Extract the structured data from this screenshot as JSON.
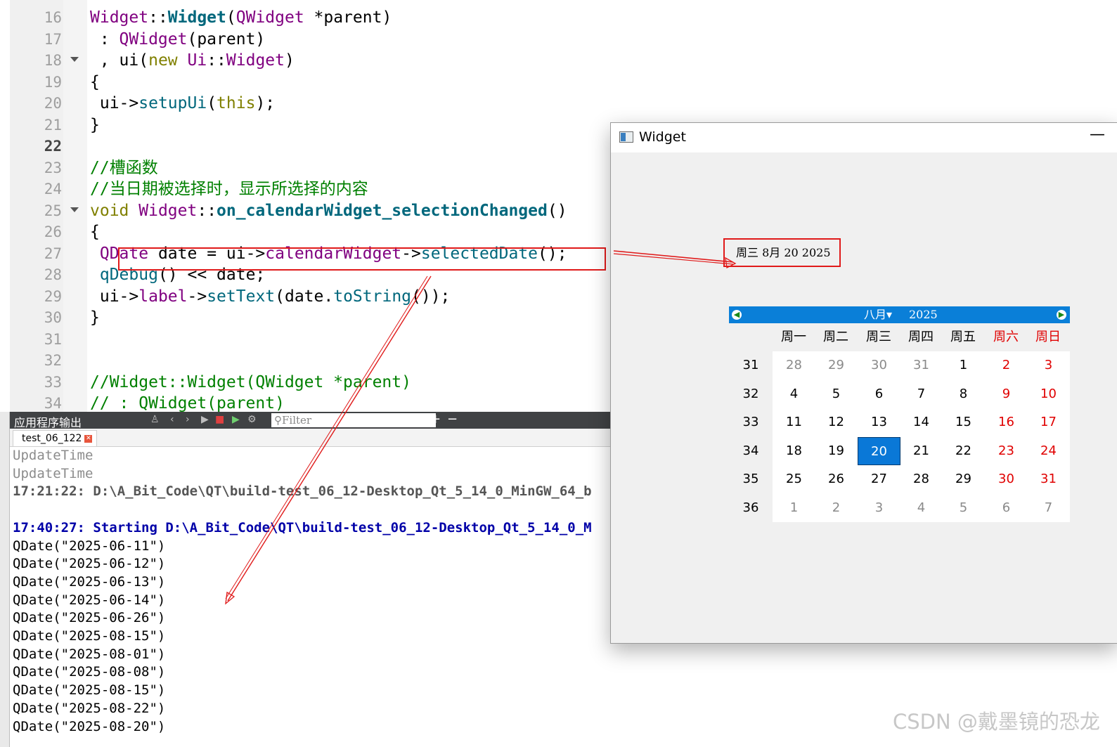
{
  "editor": {
    "lines": [
      {
        "num": "16",
        "parts": [
          [
            "type",
            "Widget"
          ],
          [
            "",
            "::"
          ],
          [
            "fnb",
            "Widget"
          ],
          [
            "",
            "("
          ],
          [
            "type",
            "QWidget"
          ],
          [
            "",
            " *parent)"
          ]
        ]
      },
      {
        "num": "17",
        "parts": [
          [
            "",
            " : "
          ],
          [
            "type",
            "QWidget"
          ],
          [
            "",
            "(parent)"
          ]
        ]
      },
      {
        "num": "18",
        "fold": true,
        "parts": [
          [
            "",
            " , ui("
          ],
          [
            "kw",
            "new"
          ],
          [
            "",
            " "
          ],
          [
            "type",
            "Ui"
          ],
          [
            "",
            "::"
          ],
          [
            "type",
            "Widget"
          ],
          [
            "",
            ")"
          ]
        ]
      },
      {
        "num": "19",
        "parts": [
          [
            "",
            "{"
          ]
        ]
      },
      {
        "num": "20",
        "parts": [
          [
            "",
            " ui->"
          ],
          [
            "fn",
            "setupUi"
          ],
          [
            "",
            "("
          ],
          [
            "kw",
            "this"
          ],
          [
            "",
            ");"
          ]
        ]
      },
      {
        "num": "21",
        "parts": [
          [
            "",
            "}"
          ]
        ]
      },
      {
        "num": "22",
        "current": true,
        "parts": []
      },
      {
        "num": "23",
        "parts": [
          [
            "cm",
            "//槽函数"
          ]
        ]
      },
      {
        "num": "24",
        "parts": [
          [
            "cm",
            "//当日期被选择时，显示所选择的内容"
          ]
        ]
      },
      {
        "num": "25",
        "fold": true,
        "parts": [
          [
            "kw",
            "void"
          ],
          [
            "",
            " "
          ],
          [
            "type",
            "Widget"
          ],
          [
            "",
            "::"
          ],
          [
            "fnb",
            "on_calendarWidget_selectionChanged"
          ],
          [
            "",
            "()"
          ]
        ]
      },
      {
        "num": "26",
        "parts": [
          [
            "",
            "{"
          ]
        ]
      },
      {
        "num": "27",
        "parts": [
          [
            "",
            " "
          ],
          [
            "type",
            "QDate"
          ],
          [
            "",
            " date = ui->"
          ],
          [
            "type",
            "calendarWidget"
          ],
          [
            "",
            "->"
          ],
          [
            "fn",
            "selectedDate"
          ],
          [
            "",
            "();"
          ]
        ]
      },
      {
        "num": "28",
        "parts": [
          [
            "",
            " "
          ],
          [
            "fn",
            "qDebug"
          ],
          [
            "",
            "() << date;"
          ]
        ]
      },
      {
        "num": "29",
        "parts": [
          [
            "",
            " ui->"
          ],
          [
            "type",
            "label"
          ],
          [
            "",
            "->"
          ],
          [
            "fn",
            "setText"
          ],
          [
            "",
            "(date."
          ],
          [
            "fn",
            "toString"
          ],
          [
            "",
            "());"
          ]
        ]
      },
      {
        "num": "30",
        "parts": [
          [
            "",
            "}"
          ]
        ]
      },
      {
        "num": "31",
        "parts": []
      },
      {
        "num": "32",
        "parts": []
      },
      {
        "num": "33",
        "parts": [
          [
            "cm",
            "//Widget::Widget(QWidget *parent)"
          ]
        ]
      },
      {
        "num": "34",
        "parts": [
          [
            "cm",
            "// : QWidget(parent)"
          ]
        ]
      }
    ]
  },
  "output_pane": {
    "title": "应用程序输出",
    "filter_placeholder": "Filter",
    "tab_label": "test_06_122",
    "log": [
      {
        "style": "gray",
        "text": "UpdateTime"
      },
      {
        "style": "gray",
        "text": "UpdateTime"
      },
      {
        "style": "gbold",
        "text": "17:21:22: D:\\A_Bit_Code\\QT\\build-test_06_12-Desktop_Qt_5_14_0_MinGW_64_b"
      },
      {
        "style": "black",
        "text": " "
      },
      {
        "style": "bbold",
        "text": "17:40:27: Starting D:\\A_Bit_Code\\QT\\build-test_06_12-Desktop_Qt_5_14_0_M"
      },
      {
        "style": "black",
        "text": "QDate(\"2025-06-11\")"
      },
      {
        "style": "black",
        "text": "QDate(\"2025-06-12\")"
      },
      {
        "style": "black",
        "text": "QDate(\"2025-06-13\")"
      },
      {
        "style": "black",
        "text": "QDate(\"2025-06-14\")"
      },
      {
        "style": "black",
        "text": "QDate(\"2025-06-26\")"
      },
      {
        "style": "black",
        "text": "QDate(\"2025-08-15\")"
      },
      {
        "style": "black",
        "text": "QDate(\"2025-08-01\")"
      },
      {
        "style": "black",
        "text": "QDate(\"2025-08-08\")"
      },
      {
        "style": "black",
        "text": "QDate(\"2025-08-15\")"
      },
      {
        "style": "black",
        "text": "QDate(\"2025-08-22\")"
      },
      {
        "style": "black",
        "text": "QDate(\"2025-08-20\")"
      }
    ]
  },
  "widget_window": {
    "title": "Widget",
    "minimize_glyph": "—",
    "date_label": "周三 8月 20 2025",
    "calendar": {
      "month": "八月▾",
      "year": "2025",
      "day_headers": [
        "周一",
        "周二",
        "周三",
        "周四",
        "周五",
        "周六",
        "周日"
      ],
      "weeks": [
        {
          "week": "31",
          "days": [
            {
              "d": "28",
              "o": true
            },
            {
              "d": "29",
              "o": true
            },
            {
              "d": "30",
              "o": true
            },
            {
              "d": "31",
              "o": true
            },
            {
              "d": "1"
            },
            {
              "d": "2"
            },
            {
              "d": "3"
            }
          ]
        },
        {
          "week": "32",
          "days": [
            {
              "d": "4"
            },
            {
              "d": "5"
            },
            {
              "d": "6"
            },
            {
              "d": "7"
            },
            {
              "d": "8"
            },
            {
              "d": "9"
            },
            {
              "d": "10"
            }
          ]
        },
        {
          "week": "33",
          "days": [
            {
              "d": "11"
            },
            {
              "d": "12"
            },
            {
              "d": "13"
            },
            {
              "d": "14"
            },
            {
              "d": "15"
            },
            {
              "d": "16"
            },
            {
              "d": "17"
            }
          ]
        },
        {
          "week": "34",
          "days": [
            {
              "d": "18"
            },
            {
              "d": "19"
            },
            {
              "d": "20",
              "sel": true
            },
            {
              "d": "21"
            },
            {
              "d": "22"
            },
            {
              "d": "23"
            },
            {
              "d": "24"
            }
          ]
        },
        {
          "week": "35",
          "days": [
            {
              "d": "25"
            },
            {
              "d": "26"
            },
            {
              "d": "27"
            },
            {
              "d": "28"
            },
            {
              "d": "29"
            },
            {
              "d": "30"
            },
            {
              "d": "31"
            }
          ]
        },
        {
          "week": "36",
          "days": [
            {
              "d": "1",
              "o": true
            },
            {
              "d": "2",
              "o": true
            },
            {
              "d": "3",
              "o": true
            },
            {
              "d": "4",
              "o": true
            },
            {
              "d": "5",
              "o": true
            },
            {
              "d": "6",
              "o": true
            },
            {
              "d": "7",
              "o": true
            }
          ]
        }
      ]
    }
  },
  "watermark": "CSDN @戴墨镜的恐龙",
  "colors": {
    "annotation_red": "#e01a1a",
    "calendar_blue": "#0a7fd8",
    "weekend_red": "#e00000"
  }
}
